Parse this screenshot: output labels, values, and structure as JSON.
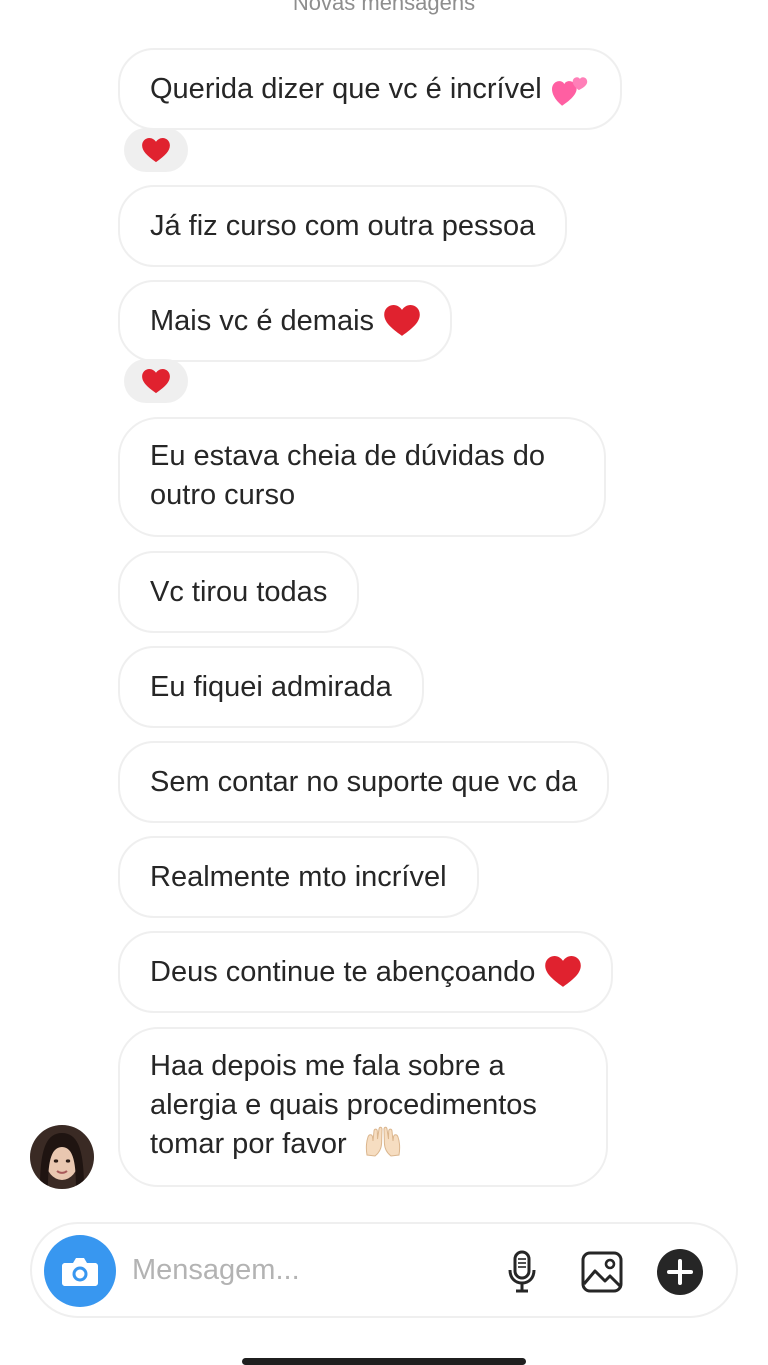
{
  "thread": {
    "divider_label": "Novas mensagens",
    "messages": [
      {
        "text": "Querida dizer que vc é incrível",
        "emoji": "two-hearts-emoji"
      },
      {
        "text": "Já fiz curso com outra pessoa"
      },
      {
        "text": "Mais vc é demais",
        "emoji": "red-heart-emoji"
      },
      {
        "text": "Eu estava cheia de dúvidas do outro curso"
      },
      {
        "text": "Vc tirou todas"
      },
      {
        "text": "Eu fiquei admirada"
      },
      {
        "text": "Sem contar no suporte que vc da"
      },
      {
        "text": "Realmente mto incrível"
      },
      {
        "text": "Deus continue te abençoando",
        "emoji": "red-heart-emoji"
      },
      {
        "text": "Haa depois me fala sobre a alergia e quais procedimentos tomar por favor",
        "emoji": "raising-hands-emoji"
      }
    ],
    "reactions": [
      {
        "emoji": "red-heart-emoji"
      },
      {
        "emoji": "red-heart-emoji"
      }
    ]
  },
  "composer": {
    "placeholder": "Mensagem...",
    "icons": [
      "camera-icon",
      "microphone-icon",
      "gallery-icon",
      "add-icon"
    ]
  },
  "colors": {
    "accent": "#3897f0",
    "bubble_border": "#efefef",
    "reaction_bg": "#efefef",
    "heart": "#e0222f",
    "text": "#262626",
    "placeholder": "#b3b3b3"
  }
}
